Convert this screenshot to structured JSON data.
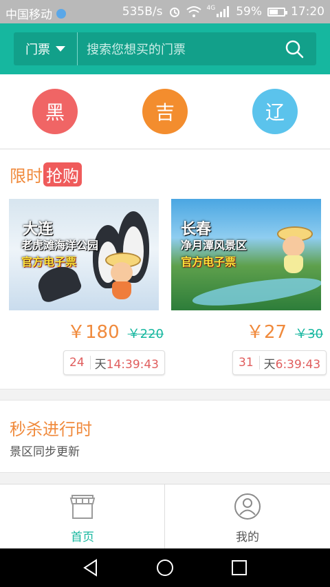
{
  "status_bar": {
    "carrier": "中国移动",
    "speed": "535B/s",
    "network": "4G",
    "battery": "59%",
    "battery_level": 0.59,
    "time": "17:20"
  },
  "header": {
    "category_label": "门票",
    "search_placeholder": "搜索您想买的门票",
    "accent_color": "#16b79f"
  },
  "provinces": [
    {
      "label": "黑",
      "color": "#f06565"
    },
    {
      "label": "吉",
      "color": "#f38d2e"
    },
    {
      "label": "辽",
      "color": "#5bc3ec"
    }
  ],
  "flash_sale": {
    "title": "限时",
    "tag": "抢购",
    "items": [
      {
        "caption_city": "大连",
        "caption_name": "老虎滩海洋公园",
        "caption_ticket": "官方电子票",
        "price": "￥180",
        "original_price": "￥220",
        "days": "24",
        "countdown_prefix": "天",
        "countdown": "14:39:43"
      },
      {
        "caption_city": "长春",
        "caption_name": "净月潭风景区",
        "caption_ticket": "官方电子票",
        "price": "￥27",
        "original_price": "￥30",
        "days": "31",
        "countdown_prefix": "天",
        "countdown": "6:39:43"
      }
    ]
  },
  "seckill": {
    "title": "秒杀进行时",
    "subtitle": "景区同步更新"
  },
  "tab_bar": {
    "home_label": "首页",
    "mine_label": "我的",
    "active_color": "#16b79f"
  }
}
